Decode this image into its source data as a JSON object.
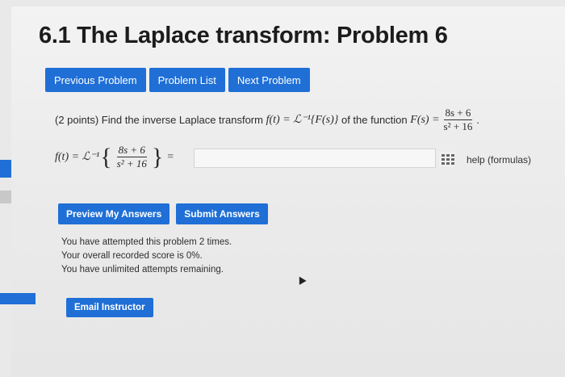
{
  "title": "6.1 The Laplace transform: Problem 6",
  "nav": {
    "previous": "Previous Problem",
    "list": "Problem List",
    "next": "Next Problem"
  },
  "problem": {
    "points": "(2 points) Find the inverse Laplace transform",
    "formula_lhs": "f(t) = ℒ⁻¹{F(s)}",
    "middle": "of the function",
    "fs": "F(s) =",
    "numerator": "8s + 6",
    "denominator": "s² + 16",
    "period": "."
  },
  "answer": {
    "lhs": "f(t) = ℒ⁻¹",
    "numerator": "8s + 6",
    "denominator": "s² + 16",
    "equals": "=",
    "value": "",
    "help": "help (formulas)"
  },
  "actions": {
    "preview": "Preview My Answers",
    "submit": "Submit Answers"
  },
  "status": {
    "line1": "You have attempted this problem 2 times.",
    "line2": "Your overall recorded score is 0%.",
    "line3": "You have unlimited attempts remaining."
  },
  "email": "Email Instructor",
  "colors": {
    "accent": "#1f6fd6"
  }
}
